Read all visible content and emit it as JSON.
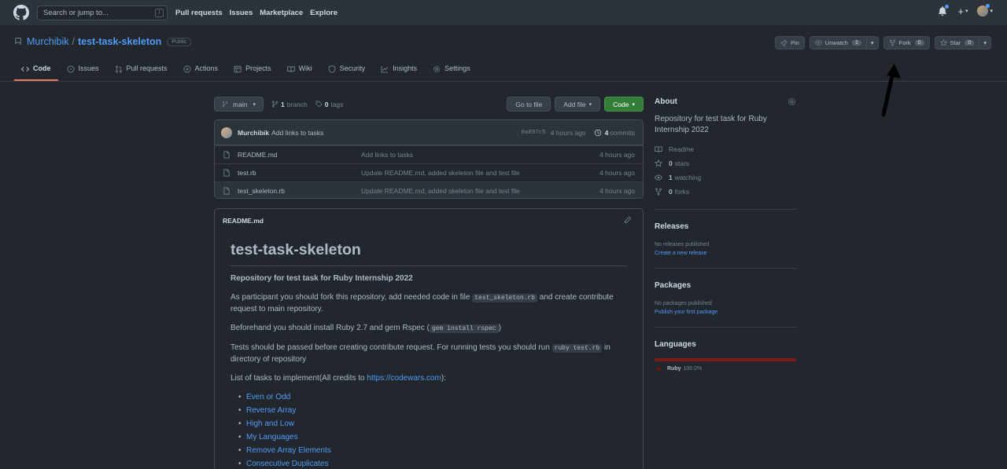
{
  "header": {
    "search_placeholder": "Search or jump to...",
    "search_shortcut": "/",
    "nav": [
      "Pull requests",
      "Issues",
      "Marketplace",
      "Explore"
    ],
    "plus": "+"
  },
  "repo": {
    "owner": "Murchibik",
    "separator": "/",
    "name": "test-task-skeleton",
    "visibility": "Public",
    "actions": {
      "pin": "Pin",
      "unwatch": "Unwatch",
      "watch_count": "1",
      "fork": "Fork",
      "fork_count": "0",
      "star": "Star",
      "star_count": "0"
    }
  },
  "tabs": [
    {
      "label": "Code",
      "icon": "code-icon",
      "active": true
    },
    {
      "label": "Issues",
      "icon": "issue-icon"
    },
    {
      "label": "Pull requests",
      "icon": "pull-request-icon"
    },
    {
      "label": "Actions",
      "icon": "play-icon"
    },
    {
      "label": "Projects",
      "icon": "table-icon"
    },
    {
      "label": "Wiki",
      "icon": "book-icon"
    },
    {
      "label": "Security",
      "icon": "shield-icon"
    },
    {
      "label": "Insights",
      "icon": "graph-icon"
    },
    {
      "label": "Settings",
      "icon": "gear-icon"
    }
  ],
  "branch_bar": {
    "branch": "main",
    "branch_count": "1",
    "branch_label": "branch",
    "tag_count": "0",
    "tag_label": "tags",
    "go_to_file": "Go to file",
    "add_file": "Add file",
    "code": "Code"
  },
  "commit": {
    "author": "Murchibik",
    "message": "Add links to tasks",
    "sha": "9a897c5",
    "age": "4 hours ago",
    "commit_count": "4",
    "commit_label": "commits"
  },
  "files": [
    {
      "name": "README.md",
      "message": "Add links to tasks",
      "age": "4 hours ago"
    },
    {
      "name": "test.rb",
      "message": "Update README.md, added skeleton file and test file",
      "age": "4 hours ago"
    },
    {
      "name": "test_skeleton.rb",
      "message": "Update README.md, added skeleton file and test file",
      "age": "4 hours ago"
    }
  ],
  "readme": {
    "filename": "README.md",
    "title": "test-task-skeleton",
    "subtitle": "Repository for test task for Ruby Internship 2022",
    "p1_a": "As participant you should fork this repository, add needed code in file ",
    "p1_code": "test_skeleton.rb",
    "p1_b": " and create contribute request to main repository.",
    "p2_a": "Beforehand you should install Ruby 2.7 and gem Rspec (",
    "p2_code": "gem install rspec",
    "p2_b": ")",
    "p3_a": "Tests should be passed before creating contribute request. For running tests you should run ",
    "p3_code": "ruby test.rb",
    "p3_b": " in directory of repository",
    "p4_a": "List of tasks to implement(All credits to ",
    "p4_link": "https://codewars.com",
    "p4_b": "):",
    "tasks": [
      "Even or Odd",
      "Reverse Array",
      "High and Low",
      "My Languages",
      "Remove Array Elements",
      "Consecutive Duplicates"
    ]
  },
  "about": {
    "title": "About",
    "description": "Repository for test task for Ruby Internship 2022",
    "readme": "Readme",
    "stars_count": "0",
    "stars_label": "stars",
    "watching_count": "1",
    "watching_label": "watching",
    "forks_count": "0",
    "forks_label": "forks"
  },
  "releases": {
    "title": "Releases",
    "none": "No releases published",
    "link": "Create a new release"
  },
  "packages": {
    "title": "Packages",
    "none": "No packages published",
    "link": "Publish your first package"
  },
  "languages": {
    "title": "Languages",
    "name": "Ruby",
    "percent": "100.0%",
    "ruby_color": "#701516"
  },
  "colors": {
    "accent": "#539bf5",
    "green": "#347d39",
    "tab_underline": "#ec775c"
  }
}
